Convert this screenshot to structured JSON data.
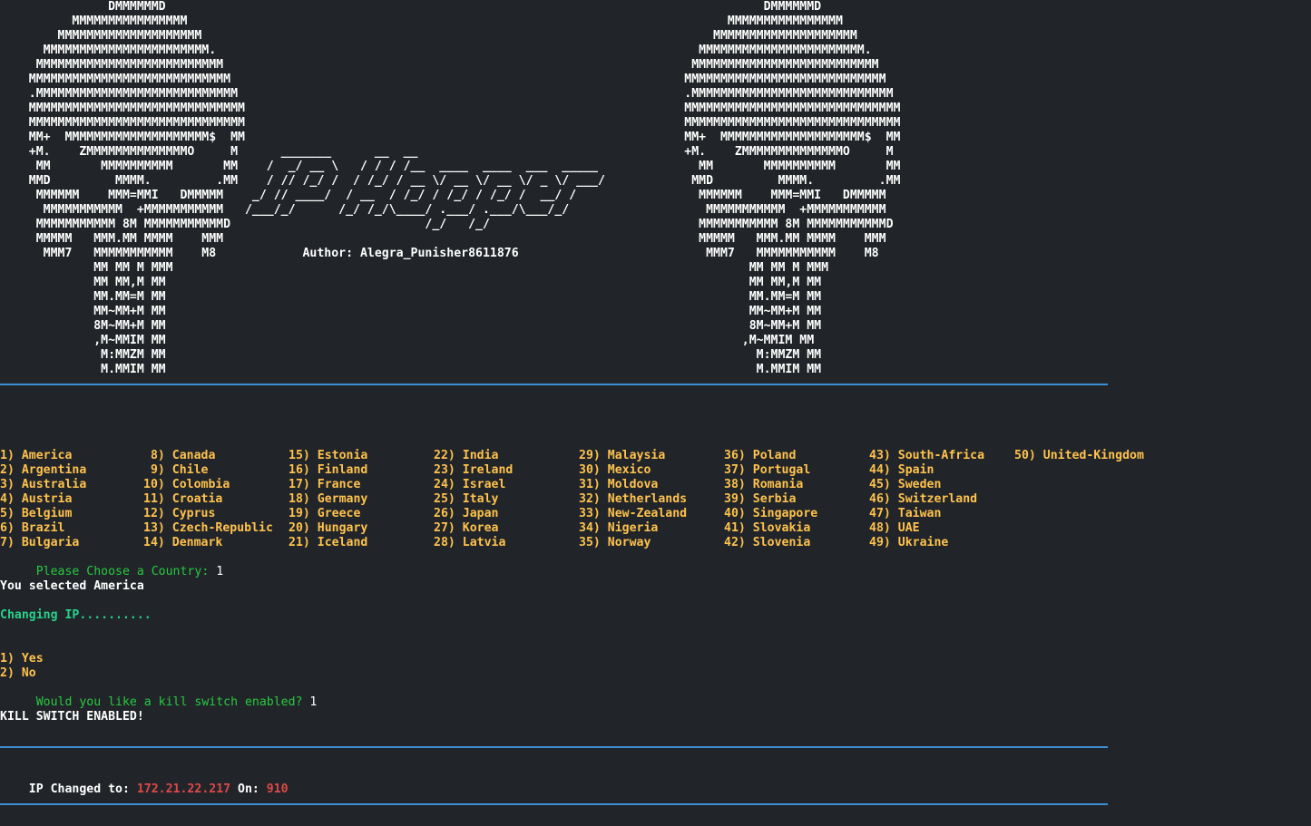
{
  "banner": {
    "ascii_art": "               DMMMMMMD                                                                                   DMMMMMMD\n          MMMMMMMMMMMMMMMM                                                                           MMMMMMMMMMMMMMMM\n        MMMMMMMMMMMMMMMMMMMM                                                                       MMMMMMMMMMMMMMMMMMMM\n      MMMMMMMMMMMMMMMMMMMMMMM.                                                                   MMMMMMMMMMMMMMMMMMMMMMM.\n     MMMMMMMMMMMMMMMMMMMMMMMMMM                                                                 MMMMMMMMMMMMMMMMMMMMMMMMMM\n    MMMMMMMMMMMMMMMMMMMMMMMMMMMM                                                               MMMMMMMMMMMMMMMMMMMMMMMMMMMM\n    .MMMMMMMMMMMMMMMMMMMMMMMMMMMM                                                              .MMMMMMMMMMMMMMMMMMMMMMMMMMMM\n    MMMMMMMMMMMMMMMMMMMMMMMMMMMMMM                                                             MMMMMMMMMMMMMMMMMMMMMMMMMMMMMM\n    MMMMMMMMMMMMMMMMMMMMMMMMMMMMMM                                                             MMMMMMMMMMMMMMMMMMMMMMMMMMMMMM\n    MM+  MMMMMMMMMMMMMMMMMMMM$  MM                                                             MM+  MMMMMMMMMMMMMMMMMMMM$  MM\n    +M.    ZMMMMMMMMMMMMMMO     M      _______      __  __                                     +M.    ZMMMMMMMMMMMMMMO     M\n     MM       MMMMMMMMMM       MM    /  _/ __ \\   / / / /__  ____  ____  ___  _____              MM       MMMMMMMMMM       MM\n    MMD         MMMM.         .MM    / // /_/ /  / /_/ / __ \\/ __ \\/ __ \\/ _ \\/ ___/            MMD         MMMM.         .MM\n     MMMMMM    MMM=MMI   DMMMMM    _/ // ____/  / __  / /_/ / /_/ / /_/ /  __/ /                 MMMMMM    MMM=MMI   DMMMMM\n      MMMMMMMMMMM  +MMMMMMMMMMM   /___/_/      /_/ /_/\\____/ .___/ .___/\\___/_/                   MMMMMMMMMMM  +MMMMMMMMMMM\n     MMMMMMMMMMM 8M MMMMMMMMMMMD                           /_/   /_/                             MMMMMMMMMMM 8M MMMMMMMMMMMD\n     MMMMM   MMM.MM MMMM    MMM                                                                  MMMMM   MMM.MM MMMM    MMM\n      MMM7   MMMMMMMMMMM    M8            Author: Alegra_Punisher8611876                          MMM7   MMMMMMMMMMM    M8\n             MM MM M MMM                                                                                MM MM M MMM\n             MM MM,M MM                                                                                 MM MM,M MM\n             MM.MM=M MM                                                                                 MM.MM=M MM\n             MM~MM+M MM                                                                                 MM~MM+M MM\n             8M~MM+M MM                                                                                 8M~MM+M MM\n             ,M~MMIM MM                                                                                ,M~MMIM MM\n              M:MMZM MM                                                                                  M:MMZM MM\n              M.MMIM MM                                                                                  M.MMIM MM"
  },
  "countries": {
    "columns": [
      [
        "1) America",
        "2) Argentina",
        "3) Australia",
        "4) Austria",
        "5) Belgium",
        "6) Brazil",
        "7) Bulgaria"
      ],
      [
        " 8) Canada",
        " 9) Chile",
        "10) Colombia",
        "11) Croatia",
        "12) Cyprus",
        "13) Czech-Republic",
        "14) Denmark"
      ],
      [
        "15) Estonia",
        "16) Finland",
        "17) France",
        "18) Germany",
        "19) Greece",
        "20) Hungary",
        "21) Iceland"
      ],
      [
        "22) India",
        "23) Ireland",
        "24) Israel",
        "25) Italy",
        "26) Japan",
        "27) Korea",
        "28) Latvia"
      ],
      [
        "29) Malaysia",
        "30) Mexico",
        "31) Moldova",
        "32) Netherlands",
        "33) New-Zealand",
        "34) Nigeria",
        "35) Norway"
      ],
      [
        "36) Poland",
        "37) Portugal",
        "38) Romania",
        "39) Serbia",
        "40) Singapore",
        "41) Slovakia",
        "42) Slovenia"
      ],
      [
        "43) South-Africa",
        "44) Spain",
        "45) Sweden",
        "46) Switzerland",
        "47) Taiwan",
        "48) UAE",
        "49) Ukraine"
      ],
      [
        "50) United-Kingdom"
      ]
    ]
  },
  "session": {
    "country_prompt": " Please Choose a Country: ",
    "country_answer": "1",
    "selected_text": "You selected America",
    "changing_text": "Changing IP..........",
    "killswitch_options": [
      "1) Yes",
      "2) No"
    ],
    "killswitch_prompt": " Would you like a kill switch enabled? ",
    "killswitch_answer": "1",
    "killswitch_status": "KILL SWITCH ENABLED!",
    "ip_label": "IP Changed to: ",
    "ip_value": "172.21.22.217",
    "on_label": " On: ",
    "on_value": "910"
  },
  "colors": {
    "background": "#212529",
    "divider": "#3d8fd6",
    "country_text": "#ffc24d",
    "prompt_text": "#27c93f",
    "status_text": "#27d18b",
    "ip_value": "#e04848"
  }
}
